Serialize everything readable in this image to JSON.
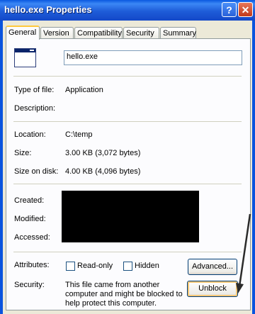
{
  "window": {
    "title": "hello.exe Properties",
    "help_glyph": "?",
    "close_glyph": "✕"
  },
  "tabs": [
    "General",
    "Version",
    "Compatibility",
    "Security",
    "Summary"
  ],
  "file_name": "hello.exe",
  "rows": {
    "type_label": "Type of file:",
    "type_value": "Application",
    "description_label": "Description:",
    "location_label": "Location:",
    "location_value": "C:\\temp",
    "size_label": "Size:",
    "size_value": "3.00 KB (3,072 bytes)",
    "size_on_disk_label": "Size on disk:",
    "size_on_disk_value": "4.00 KB (4,096 bytes)",
    "created_label": "Created:",
    "modified_label": "Modified:",
    "accessed_label": "Accessed:",
    "attributes_label": "Attributes:",
    "readonly_label": "Read-only",
    "hidden_label": "Hidden",
    "advanced_label": "Advanced...",
    "security_label": "Security:",
    "security_text_1": "This file came from another",
    "security_text_2": "computer and might be blocked to",
    "security_text_3": "help protect this computer.",
    "unblock_label": "Unblock"
  },
  "colors": {
    "titlebar": "#0A58E0",
    "face": "#ECE9D8",
    "panel": "#FCFCFE",
    "active_tab_accent": "#FFC83C",
    "annotation_arrow": "#2B2B2B"
  }
}
